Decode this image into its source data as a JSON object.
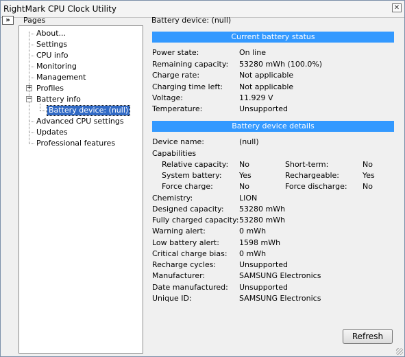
{
  "window": {
    "title": "RightMark CPU Clock Utility",
    "close_glyph": "✕",
    "toggle_glyph": "»"
  },
  "sidebar": {
    "title": "Pages",
    "items": [
      {
        "label": "About..."
      },
      {
        "label": "Settings"
      },
      {
        "label": "CPU info"
      },
      {
        "label": "Monitoring"
      },
      {
        "label": "Management"
      },
      {
        "label": "Profiles",
        "expander": "+"
      },
      {
        "label": "Battery info",
        "expander": "−"
      },
      {
        "label": "Battery device: (null)"
      },
      {
        "label": "Advanced CPU settings"
      },
      {
        "label": "Updates"
      },
      {
        "label": "Professional features"
      }
    ]
  },
  "main": {
    "section_title": "Battery device: (null)",
    "status": {
      "header": "Current battery status",
      "rows": [
        {
          "label": "Power state:",
          "value": "On line"
        },
        {
          "label": "Remaining capacity:",
          "value": "53280 mWh (100.0%)"
        },
        {
          "label": "Charge rate:",
          "value": "Not applicable"
        },
        {
          "label": "Charging time left:",
          "value": "Not applicable"
        },
        {
          "label": "Voltage:",
          "value": "11.929 V"
        },
        {
          "label": "Temperature:",
          "value": "Unsupported"
        }
      ]
    },
    "details": {
      "header": "Battery device details",
      "device_name": {
        "label": "Device name:",
        "value": "(null)"
      },
      "capabilities": {
        "title": "Capabilities",
        "left": [
          {
            "label": "Relative capacity:",
            "value": "No"
          },
          {
            "label": "System battery:",
            "value": "Yes"
          },
          {
            "label": "Force charge:",
            "value": "No"
          }
        ],
        "right": [
          {
            "label": "Short-term:",
            "value": "No"
          },
          {
            "label": "Rechargeable:",
            "value": "Yes"
          },
          {
            "label": "Force discharge:",
            "value": "No"
          }
        ]
      },
      "rows": [
        {
          "label": "Chemistry:",
          "value": "LION"
        },
        {
          "label": "Designed capacity:",
          "value": "53280 mWh"
        },
        {
          "label": "Fully charged capacity:",
          "value": "53280 mWh"
        },
        {
          "label": "Warning alert:",
          "value": "0 mWh"
        },
        {
          "label": "Low battery alert:",
          "value": "1598 mWh"
        },
        {
          "label": "Critical charge bias:",
          "value": "0 mWh"
        },
        {
          "label": "Recharge cycles:",
          "value": "Unsupported"
        },
        {
          "label": "Manufacturer:",
          "value": "SAMSUNG Electronics"
        },
        {
          "label": "Date manufactured:",
          "value": "Unsupported"
        },
        {
          "label": "Unique ID:",
          "value": "SAMSUNG Electronics"
        }
      ]
    },
    "refresh_label": "Refresh"
  },
  "colors": {
    "band": "#3399ff",
    "selected": "#316ac5"
  }
}
